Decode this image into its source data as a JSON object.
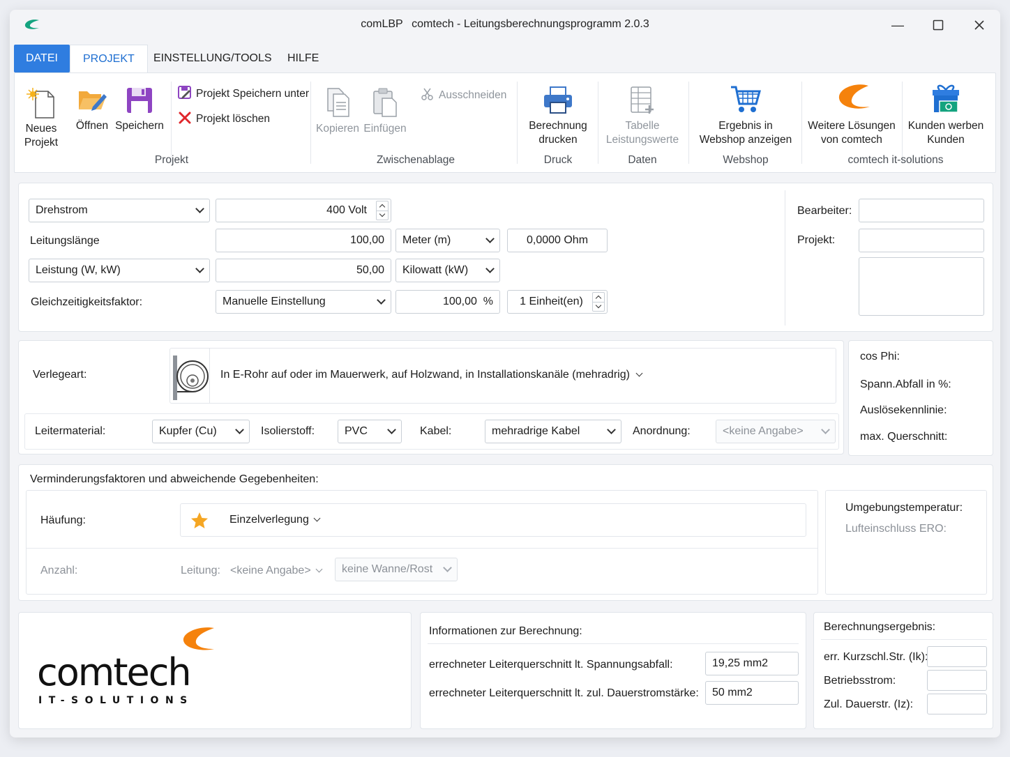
{
  "titlebar": {
    "app_short": "comLBP",
    "title": "comtech - Leitungsberechnungsprogramm 2.0.3"
  },
  "menu": {
    "datei": "DATEI",
    "projekt": "PROJEKT",
    "tools": "EINSTELLUNG/TOOLS",
    "hilfe": "HILFE"
  },
  "ribbon": {
    "neues_projekt_1": "Neues",
    "neues_projekt_2": "Projekt",
    "oeffnen": "Öffnen",
    "speichern": "Speichern",
    "speichern_unter": "Projekt Speichern unter",
    "loeschen": "Projekt löschen",
    "group_projekt": "Projekt",
    "kopieren": "Kopieren",
    "einfuegen": "Einfügen",
    "ausschneiden": "Ausschneiden",
    "group_zwischenablage": "Zwischenablage",
    "drucken_1": "Berechnung",
    "drucken_2": "drucken",
    "group_druck": "Druck",
    "tabelle_1": "Tabelle",
    "tabelle_2": "Leistungswerte",
    "group_daten": "Daten",
    "webshop_1": "Ergebnis in",
    "webshop_2": "Webshop anzeigen",
    "group_webshop": "Webshop",
    "weitere_1": "Weitere Lösungen",
    "weitere_2": "von comtech",
    "kunden_1": "Kunden werben",
    "kunden_2": "Kunden",
    "group_comtech": "comtech it-solutions"
  },
  "input": {
    "stromart": "Drehstrom",
    "spannung": "400 Volt",
    "leitungslaenge_label": "Leitungslänge",
    "laenge": "100,00",
    "laenge_unit": "Meter (m)",
    "ohm": "0,0000 Ohm",
    "leistung_type": "Leistung (W, kW)",
    "leistung": "50,00",
    "leistung_unit": "Kilowatt (kW)",
    "gzf_label": "Gleichzeitigkeitsfaktor:",
    "gzf_mode": "Manuelle Einstellung",
    "gzf_percent": "100,00  %",
    "einheiten": "1 Einheit(en)",
    "bearbeiter_label": "Bearbeiter:",
    "projekt_label": "Projekt:"
  },
  "verlegung": {
    "label": "Verlegeart:",
    "value": "In E-Rohr auf oder im Mauerwerk, auf Holzwand, in Installationskanäle (mehradrig)",
    "leitermaterial_label": "Leitermaterial:",
    "leitermaterial": "Kupfer (Cu)",
    "isolierstoff_label": "Isolierstoff:",
    "isolierstoff": "PVC",
    "kabel_label": "Kabel:",
    "kabel": "mehradrige Kabel",
    "anordnung_label": "Anordnung:",
    "anordnung": "<keine Angabe>"
  },
  "side": {
    "cos_phi": "cos Phi:",
    "spann_abfall": "Spann.Abfall in %:",
    "ausloese": "Auslösekennlinie:",
    "max_querschnitt": "max. Querschnitt:"
  },
  "vermind": {
    "title": "Verminderungsfaktoren und abweichende Gegebenheiten:",
    "haeufung_label": "Häufung:",
    "haeufung": "Einzelverlegung",
    "anzahl_label": "Anzahl:",
    "leitung_label": "Leitung:",
    "leitung": "<keine Angabe>",
    "wanne": "keine Wanne/Rost",
    "umgebung": "Umgebungstemperatur:",
    "lufteinschluss": "Lufteinschluss ERO:"
  },
  "logo": {
    "name": "comtech",
    "sub": "IT-SOLUTIONS"
  },
  "info": {
    "title": "Informationen zur Berechnung:",
    "row1_label": "errechneter Leiterquerschnitt lt. Spannungsabfall:",
    "row1_value": "19,25 mm2",
    "row2_label": "errechneter Leiterquerschnitt lt. zul. Dauerstromstärke:",
    "row2_value": "50 mm2"
  },
  "result": {
    "title": "Berechnungsergebnis:",
    "kurzschl": "err. Kurzschl.Str. (Ik):",
    "betriebsstrom": "Betriebsstrom:",
    "dauerstr": "Zul. Dauerstr. (Iz):"
  },
  "colors": {
    "accent": "#2f7de0",
    "brand_orange": "#f5820c",
    "brand_green": "#14a37f"
  }
}
